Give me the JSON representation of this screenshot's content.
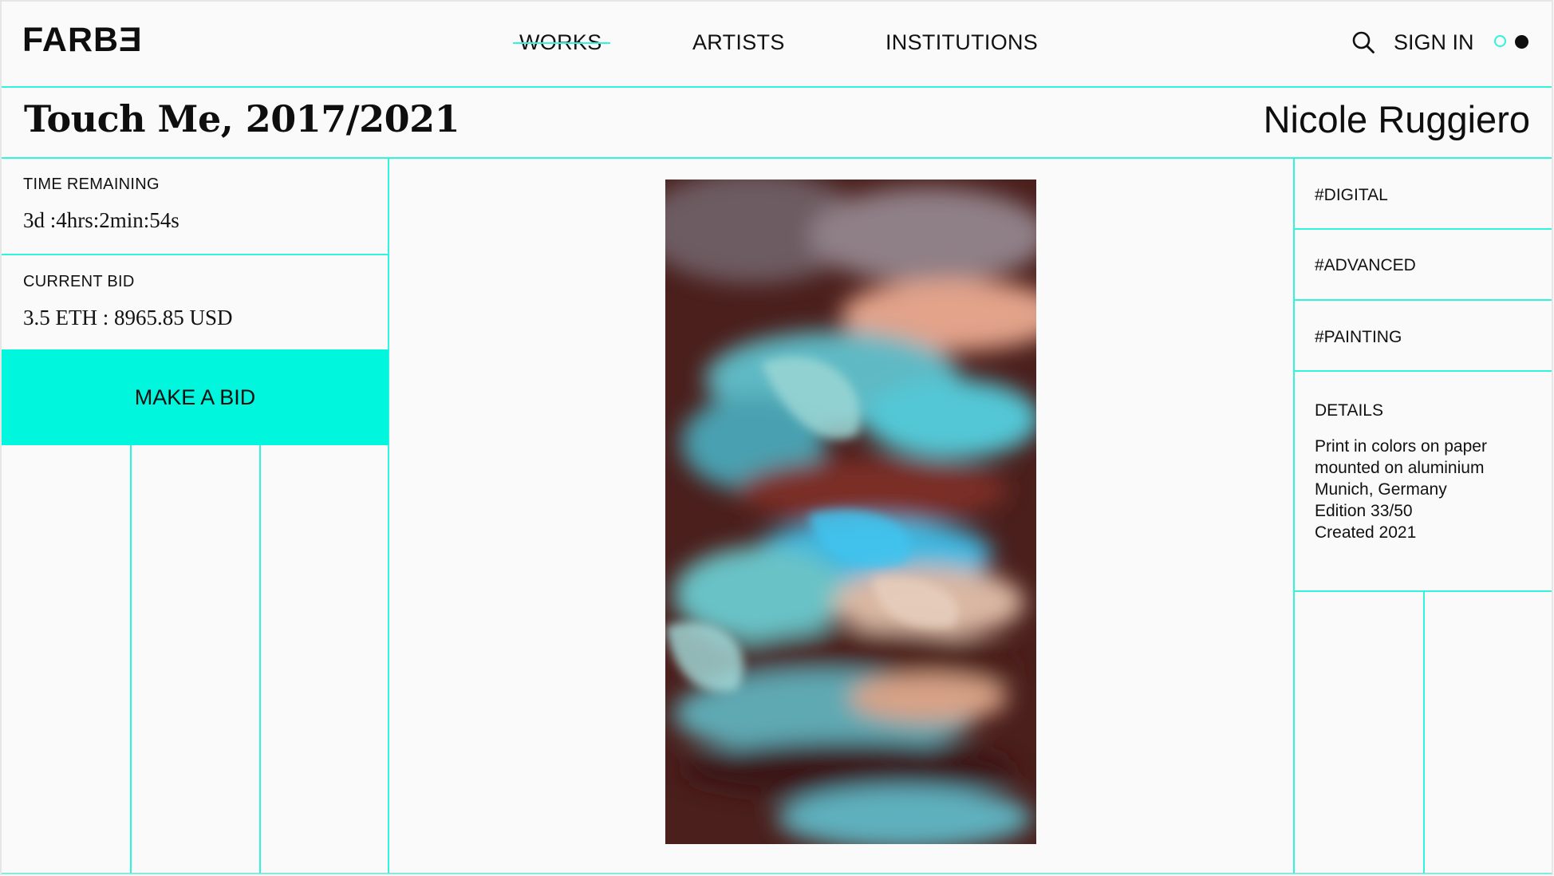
{
  "header": {
    "logo": "FARBƎ",
    "nav": [
      {
        "label": "WORKS",
        "active": true
      },
      {
        "label": "ARTISTS",
        "active": false
      },
      {
        "label": "INSTITUTIONS",
        "active": false
      }
    ],
    "search_icon": "search-icon",
    "sign_in": "SIGN IN",
    "theme_toggle_icons": [
      "outline-circle-icon",
      "filled-circle-icon"
    ]
  },
  "work": {
    "title": "Touch Me, 2017/2021",
    "artist": "Nicole Ruggiero"
  },
  "auction": {
    "time_label": "TIME REMAINING",
    "time_value": "3d :4hrs:2min:54s",
    "bid_label": "CURRENT BID",
    "bid_value": "3.5 ETH : 8965.85 USD",
    "bid_button": "MAKE A BID"
  },
  "tags": [
    "#DIGITAL",
    "#ADVANCED",
    "#PAINTING"
  ],
  "details": {
    "label": "DETAILS",
    "lines": [
      "Print in colors on paper",
      "mounted on aluminium",
      "Munich, Germany",
      "Edition 33/50",
      "Created 2021"
    ]
  },
  "colors": {
    "accent": "#2ef5dc",
    "button": "#00f7dd",
    "background": "#fafafa",
    "text": "#111111"
  }
}
